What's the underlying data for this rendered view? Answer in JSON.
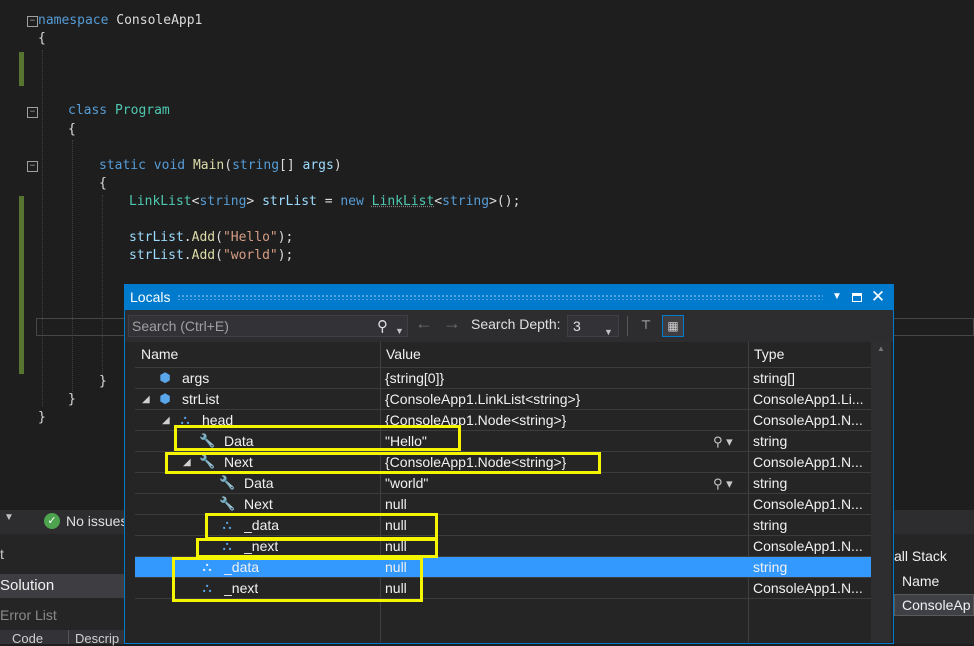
{
  "editor": {
    "lines": {
      "l1": {
        "kw": "namespace",
        "rest": " ConsoleApp1"
      },
      "l2": "{",
      "l6": {
        "kw": "class",
        "ty": "Program"
      },
      "l7": "{",
      "l9": {
        "kw1": "static",
        "kw2": "void",
        "fn": "Main",
        "p1": "(",
        "kw3": "string",
        "p2": "[] ",
        "pm": "args",
        "p3": ")"
      },
      "l10": "{",
      "l11": {
        "ty1": "LinkList",
        "a": "<",
        "kw1": "string",
        "b": "> ",
        "pm": "strList",
        "c": " = ",
        "kw2": "new",
        "d": " ",
        "ty2": "LinkList",
        "e": "<",
        "kw3": "string",
        "f": ">();"
      },
      "l13": {
        "pm": "strList",
        "a": ".",
        "fn": "Add",
        "b": "(",
        "st": "\"Hello\"",
        "c": ");"
      },
      "l14": {
        "pm": "strList",
        "a": ".",
        "fn": "Add",
        "b": "(",
        "st": "\"world\"",
        "c": ");"
      },
      "l21": "}",
      "l22": "}",
      "l23": "}"
    }
  },
  "background": {
    "no_issues": "No issues",
    "solution": "Solution",
    "error_list": "Error List",
    "code_col": "Code",
    "descr_col": "Descrip",
    "call_stack": "all Stack",
    "name_col": "Name",
    "consoleapp": "ConsoleAp"
  },
  "locals": {
    "title": "Locals",
    "search_placeholder": "Search (Ctrl+E)",
    "search_depth_label": "Search Depth:",
    "search_depth_value": "3",
    "columns": {
      "name": "Name",
      "value": "Value",
      "type": "Type"
    },
    "rows": [
      {
        "name": "args",
        "value": "{string[0]}",
        "type": "string[]"
      },
      {
        "name": "strList",
        "value": "{ConsoleApp1.LinkList<string>}",
        "type": "ConsoleApp1.Li..."
      },
      {
        "name": "head",
        "value": "{ConsoleApp1.Node<string>}",
        "type": "ConsoleApp1.N..."
      },
      {
        "name": "Data",
        "value": "\"Hello\"",
        "type": "string"
      },
      {
        "name": "Next",
        "value": "{ConsoleApp1.Node<string>}",
        "type": "ConsoleApp1.N..."
      },
      {
        "name": "Data",
        "value": "\"world\"",
        "type": "string"
      },
      {
        "name": "Next",
        "value": "null",
        "type": "ConsoleApp1.N..."
      },
      {
        "name": "_data",
        "value": "null",
        "type": "string"
      },
      {
        "name": "_next",
        "value": "null",
        "type": "ConsoleApp1.N..."
      },
      {
        "name": "_data",
        "value": "null",
        "type": "string"
      },
      {
        "name": "_next",
        "value": "null",
        "type": "ConsoleApp1.N..."
      }
    ],
    "selected_row": 9
  },
  "colors": {
    "accent": "#007acc",
    "selection": "#3399ff",
    "highlight_box": "#f5f500"
  }
}
